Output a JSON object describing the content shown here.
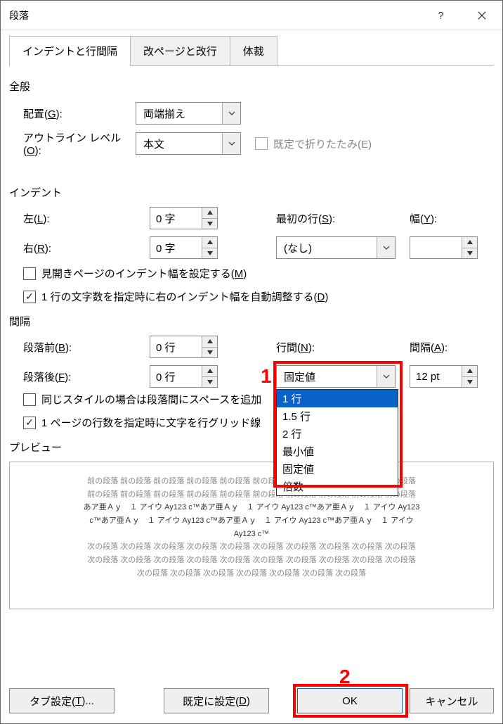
{
  "title": "段落",
  "tabs": {
    "t0": "インデントと行間隔",
    "t1": "改ページと改行",
    "t2": "体裁"
  },
  "sections": {
    "general": "全般",
    "indent": "インデント",
    "spacing": "間隔",
    "preview": "プレビュー"
  },
  "labels": {
    "alignment_pre": "配置(",
    "alignment_key": "G",
    "alignment_post": "):",
    "outline_pre": "アウトライン レベル(",
    "outline_key": "O",
    "outline_post": "):",
    "left_pre": "左(",
    "left_key": "L",
    "left_post": "):",
    "right_pre": "右(",
    "right_key": "R",
    "right_post": "):",
    "firstline_pre": "最初の行(",
    "firstline_key": "S",
    "firstline_post": "):",
    "width_pre": "幅(",
    "width_key": "Y",
    "width_post": "):",
    "before_pre": "段落前(",
    "before_key": "B",
    "before_post": "):",
    "after_pre": "段落後(",
    "after_key": "F",
    "after_post": "):",
    "linespace_pre": "行間(",
    "linespace_key": "N",
    "linespace_post": "):",
    "at_pre": "間隔(",
    "at_key": "A",
    "at_post": "):"
  },
  "values": {
    "alignment": "両端揃え",
    "outline": "本文",
    "collapse_default": "既定で折りたたみ(E)",
    "left": "0 字",
    "right": "0 字",
    "firstline": "(なし)",
    "width": "",
    "before": "0 行",
    "after": "0 行",
    "linespace": "固定値",
    "at": "12 pt"
  },
  "checkbox": {
    "mirror_pre": "見開きページのインデント幅を設定する(",
    "mirror_key": "M",
    "mirror_post": ")",
    "auto_indent_pre": "1 行の文字数を指定時に右のインデント幅を自動調整する(",
    "auto_indent_key": "D",
    "auto_indent_post": ")",
    "same_style": "同じスタイルの場合は段落間にスペースを追加",
    "snap_grid": "1 ページの行数を指定時に文字を行グリッド線"
  },
  "dropdown_options": {
    "o0": "1 行",
    "o1": "1.5 行",
    "o2": "2 行",
    "o3": "最小値",
    "o4": "固定値",
    "o5": "倍数"
  },
  "annotations": {
    "one": "1",
    "two": "2"
  },
  "preview": {
    "prev_line": "前の段落 前の段落 前の段落 前の段落 前の段落 前の段落 前の段落 前の段落 前の段落 前の段落",
    "sample1": "あア亜Ａｙ　１ アイウ Ay123 c™あア亜Ａｙ　１ アイウ Ay123 c™あア亜Ａｙ　１ アイウ Ay123",
    "sample2": "c™あア亜Ａｙ　１ アイウ Ay123 c™あア亜Ａｙ　１ アイウ Ay123 c™あア亜Ａｙ　１ アイウ",
    "sample3": "Ay123 c™",
    "next_line": "次の段落 次の段落 次の段落 次の段落 次の段落 次の段落 次の段落 次の段落 次の段落 次の段落",
    "next_line2": "次の段落 次の段落 次の段落 次の段落 次の段落 次の段落 次の段落"
  },
  "footer": {
    "tab_settings_pre": "タブ設定(",
    "tab_settings_key": "T",
    "tab_settings_post": ")...",
    "set_default_pre": "既定に設定(",
    "set_default_key": "D",
    "set_default_post": ")",
    "ok": "OK",
    "cancel": "キャンセル"
  }
}
